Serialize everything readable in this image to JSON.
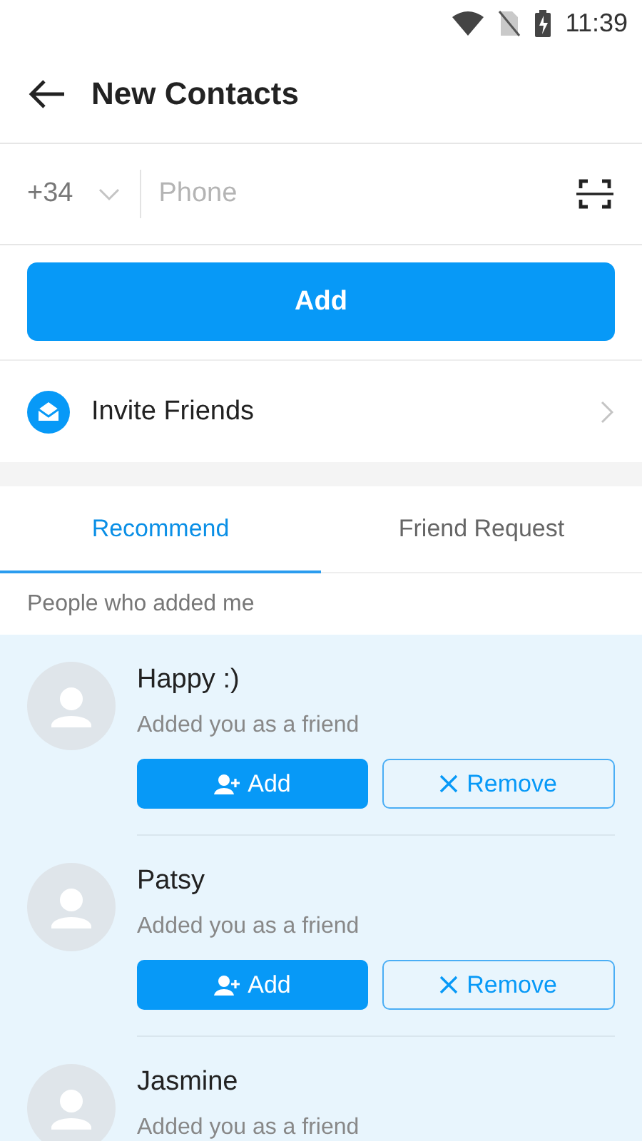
{
  "status_bar": {
    "time": "11:39"
  },
  "header": {
    "title": "New Contacts"
  },
  "phone": {
    "country_code": "+34",
    "placeholder": "Phone"
  },
  "add_button": "Add",
  "invite": {
    "label": "Invite Friends"
  },
  "tabs": [
    {
      "label": "Recommend",
      "selected": true
    },
    {
      "label": "Friend Request",
      "selected": false
    }
  ],
  "section_label": "People who added me",
  "requests": [
    {
      "name": "Happy :)",
      "message": "Added you as a friend",
      "add_label": "Add",
      "remove_label": "Remove"
    },
    {
      "name": "Patsy",
      "message": "Added you as a friend",
      "add_label": "Add",
      "remove_label": "Remove"
    },
    {
      "name": "Jasmine",
      "message": "Added you as a friend"
    }
  ]
}
